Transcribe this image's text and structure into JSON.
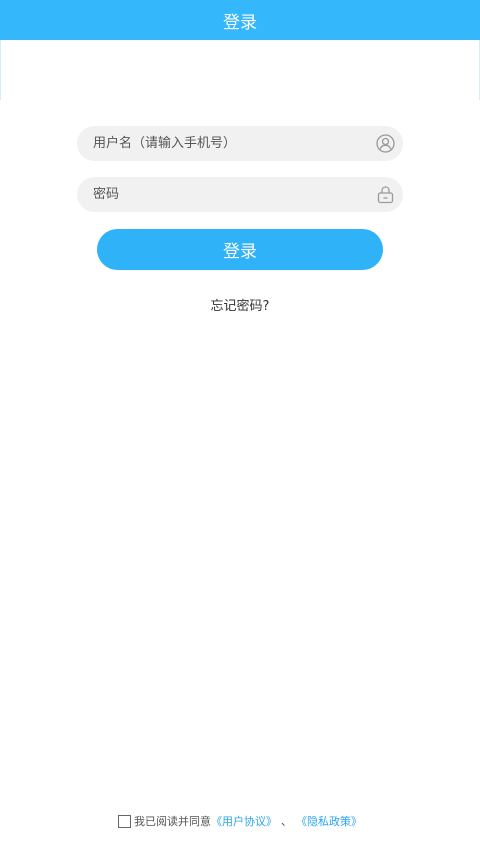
{
  "header": {
    "title": "登录"
  },
  "form": {
    "username_placeholder": "用户名（请输入手机号）",
    "password_placeholder": "密码",
    "login_label": "登录",
    "forgot_label": "忘记密码?"
  },
  "agreement": {
    "text": "我已阅读并同意",
    "user_agreement": "《用户协议》",
    "separator": "、",
    "privacy_policy": "《隐私政策》",
    "checked": false
  },
  "colors": {
    "header_bg": "#35b8fb",
    "button_bg": "#2fb2f7",
    "link": "#2aa6ee",
    "field_bg": "#f1f1f1"
  },
  "icons": {
    "username": "user-icon",
    "password": "lock-icon"
  }
}
